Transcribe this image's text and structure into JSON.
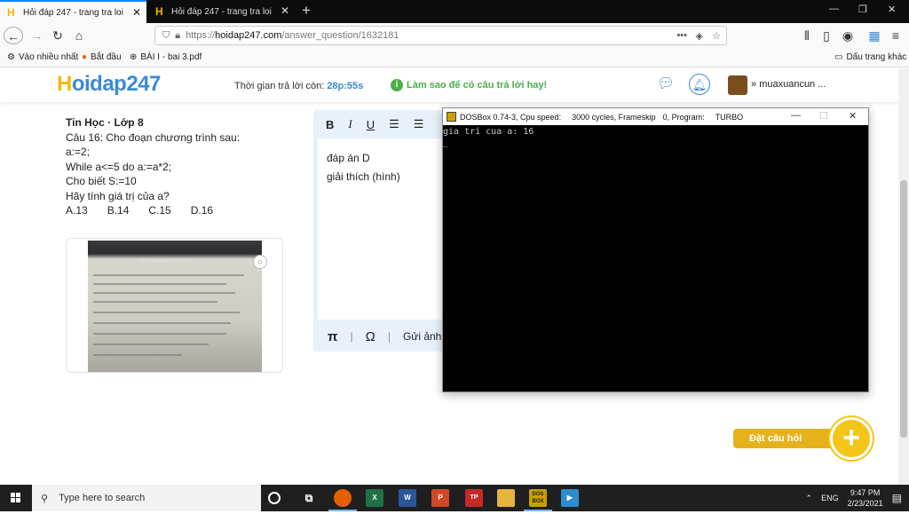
{
  "browser": {
    "tabs": [
      {
        "title": "Hỏi đáp 247 - trang tra loi",
        "active": true
      },
      {
        "title": "Hỏi đáp 247 - trang tra loi",
        "active": false
      }
    ],
    "url_prefix": "https://",
    "url_host": "hoidap247.com",
    "url_path": "/answer_question/1632181",
    "bookmarks": [
      "Vào nhiều nhất",
      "Bắt đầu",
      "BÀI I - bai 3.pdf"
    ],
    "other_bookmarks": "Dấu trang khác"
  },
  "site": {
    "logo_h": "H",
    "logo_rest": "oidap247",
    "timer_label": "Thời gian trả lời còn:",
    "timer_value": "28p:55s",
    "howto": "Làm sao để có câu trả lời hay!",
    "username": "muaxuancun ..."
  },
  "question": {
    "subject": "Tin Học · Lớp 8",
    "lines": [
      "Câu 16: Cho đoạn chương trình sau:",
      "a:=2;",
      "While a<=5 do a:=a*2;",
      "Cho biết S:=10",
      "Hãy tính giá trị của a?"
    ],
    "options": [
      "A.13",
      "B.14",
      "C.15",
      "D.16"
    ],
    "photo_title": "Bài tập tin học 8_Tuần 22"
  },
  "editor": {
    "lines": [
      "đáp án D",
      "giải thích (hình)"
    ],
    "send_image": "Gửi ảnh:"
  },
  "dosbox": {
    "title_app": "DOSBox 0.74-3, Cpu speed:",
    "title_cycles": "3000 cycles, Frameskip",
    "title_fs": "0, Program:",
    "title_prog": "TURBO",
    "output": "gia tri cua a: 16\n_"
  },
  "ask_button": "Đặt câu hỏi",
  "taskbar": {
    "search_placeholder": "Type here to search",
    "lang": "ENG",
    "time": "9:47 PM",
    "date": "2/23/2021"
  },
  "colors": {
    "brand_blue": "#3c8ad1",
    "brand_yellow": "#f5b800",
    "howto_green": "#4cae4c"
  }
}
